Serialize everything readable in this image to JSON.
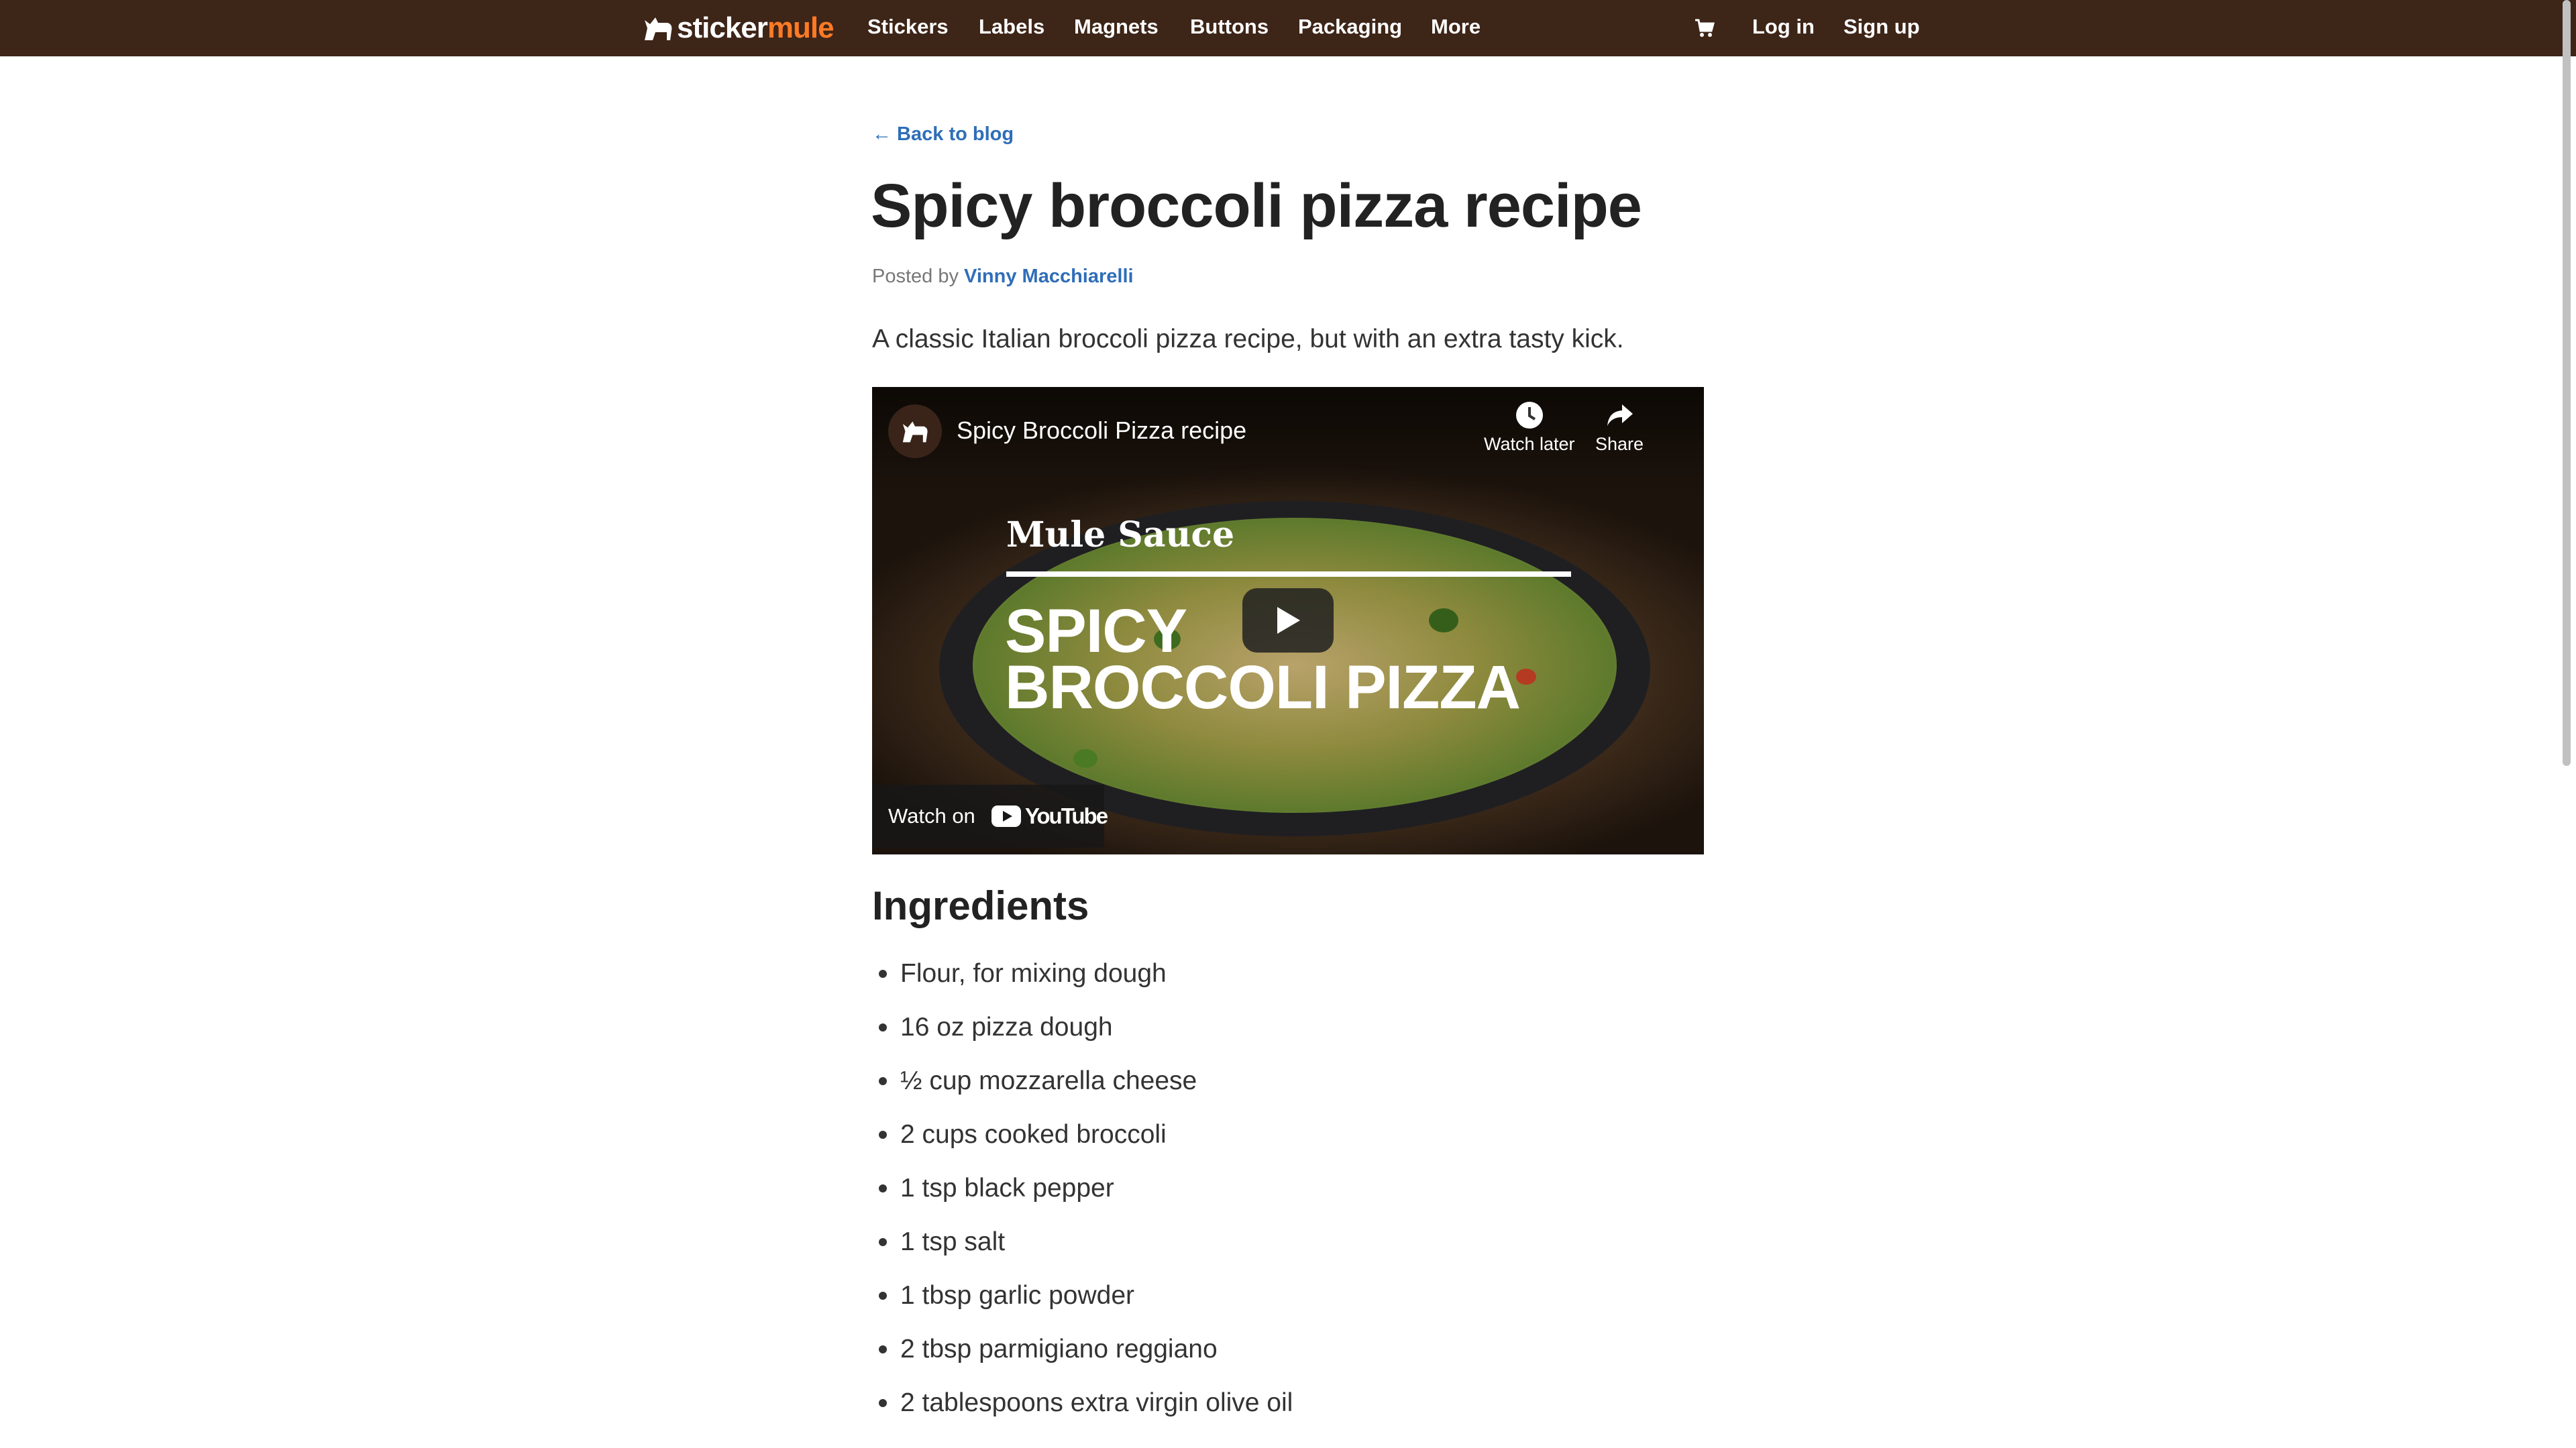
{
  "brand": {
    "part1": "sticker",
    "part2": "mule",
    "accent": "#ff7a24",
    "nav_bg": "#3d2518"
  },
  "nav": {
    "items": [
      "Stickers",
      "Labels",
      "Magnets",
      "Buttons",
      "Packaging",
      "More"
    ],
    "cart_icon": "cart-icon",
    "login": "Log in",
    "signup": "Sign up"
  },
  "article": {
    "back_link": "← Back to blog",
    "title": "Spicy broccoli pizza recipe",
    "posted_by": "Posted by",
    "author": "Vinny Macchiarelli",
    "intro": "A classic Italian broccoli pizza recipe, but with an extra tasty kick.",
    "link_color": "#2f6eb8"
  },
  "video": {
    "title": "Spicy Broccoli Pizza recipe",
    "watch_later": "Watch later",
    "share": "Share",
    "brand_overlay": "Mule Sauce",
    "overlay_line1": "SPICY",
    "overlay_line2": "BROCCOLI PIZZA",
    "watch_on": "Watch on",
    "youtube": "YouTube"
  },
  "ingredients": {
    "heading": "Ingredients",
    "items": [
      "Flour, for mixing dough",
      "16 oz pizza dough",
      "½ cup mozzarella cheese",
      "2 cups cooked broccoli",
      "1 tsp black pepper",
      "1 tsp salt",
      "1 tbsp garlic powder",
      "2 tbsp parmigiano reggiano",
      "2 tablespoons extra virgin olive oil"
    ]
  }
}
